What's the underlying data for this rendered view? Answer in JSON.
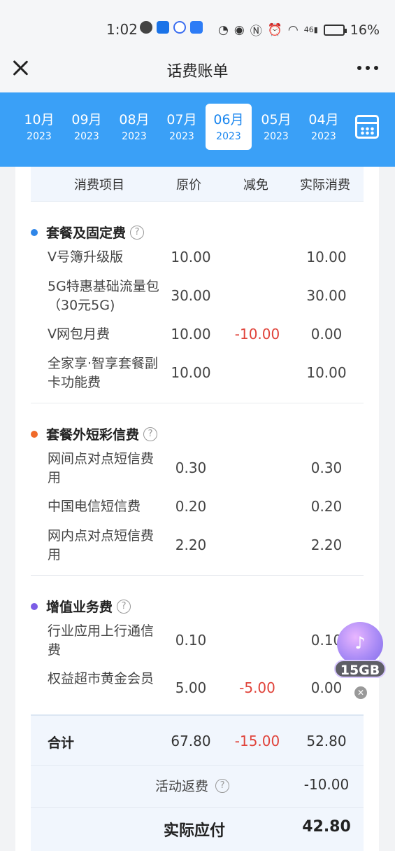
{
  "status_bar": {
    "time": "1:02",
    "signal": "46",
    "battery_percent": "16%"
  },
  "header": {
    "title": "话费账单"
  },
  "months": [
    {
      "month": "10月",
      "year": "2023"
    },
    {
      "month": "09月",
      "year": "2023"
    },
    {
      "month": "08月",
      "year": "2023"
    },
    {
      "month": "07月",
      "year": "2023"
    },
    {
      "month": "06月",
      "year": "2023",
      "active": true
    },
    {
      "month": "05月",
      "year": "2023"
    },
    {
      "month": "04月",
      "year": "2023"
    }
  ],
  "table_header": {
    "item": "消费项目",
    "original": "原价",
    "discount": "减免",
    "actual": "实际消费"
  },
  "sections": [
    {
      "title": "套餐及固定费",
      "dot_color": "#2f86e8",
      "rows": [
        {
          "name": "V号簿升级版",
          "original": "10.00",
          "discount": "",
          "actual": "10.00"
        },
        {
          "name": "5G特惠基础流量包（30元5G)",
          "original": "30.00",
          "discount": "",
          "actual": "30.00"
        },
        {
          "name": "V网包月费",
          "original": "10.00",
          "discount": "-10.00",
          "actual": "0.00"
        },
        {
          "name": "全家享·智享套餐副卡功能费",
          "original": "10.00",
          "discount": "",
          "actual": "10.00"
        }
      ]
    },
    {
      "title": "套餐外短彩信费",
      "dot_color": "#f06a2a",
      "rows": [
        {
          "name": "网间点对点短信费用",
          "original": "0.30",
          "discount": "",
          "actual": "0.30"
        },
        {
          "name": "中国电信短信费",
          "original": "0.20",
          "discount": "",
          "actual": "0.20"
        },
        {
          "name": "网内点对点短信费用",
          "original": "2.20",
          "discount": "",
          "actual": "2.20"
        }
      ]
    },
    {
      "title": "增值业务费",
      "dot_color": "#7b5ce6",
      "rows": [
        {
          "name": "行业应用上行通信费",
          "original": "0.10",
          "discount": "",
          "actual": "0.10"
        },
        {
          "name": "权益超市黄金会员",
          "original": "5.00",
          "discount": "-5.00",
          "actual": "0.00"
        }
      ]
    }
  ],
  "summary": {
    "total_label": "合计",
    "total_original": "67.80",
    "total_discount": "-15.00",
    "total_actual": "52.80",
    "rebate_label": "活动返费",
    "rebate_value": "-10.00",
    "payable_label": "实际应付",
    "payable_value": "42.80"
  },
  "float_widget": {
    "label": "15GB"
  }
}
